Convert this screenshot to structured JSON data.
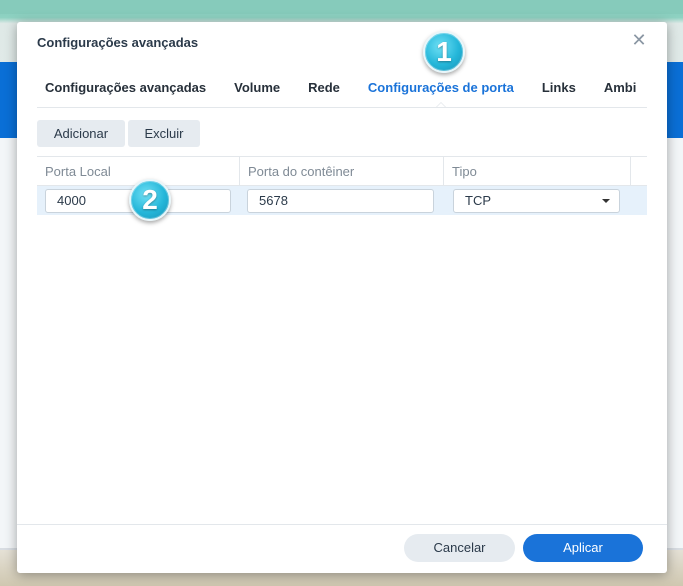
{
  "dialog": {
    "title": "Configurações avançadas",
    "close_icon": "close-icon"
  },
  "tabs": [
    {
      "label": "Configurações avançadas",
      "active": false
    },
    {
      "label": "Volume",
      "active": false
    },
    {
      "label": "Rede",
      "active": false
    },
    {
      "label": "Configurações de porta",
      "active": true
    },
    {
      "label": "Links",
      "active": false
    },
    {
      "label": "Ambi",
      "active": false
    }
  ],
  "toolbar": {
    "add_label": "Adicionar",
    "delete_label": "Excluir"
  },
  "table": {
    "columns": [
      "Porta Local",
      "Porta do contêiner",
      "Tipo"
    ],
    "rows": [
      {
        "local_port": "4000",
        "container_port": "5678",
        "type": "TCP"
      }
    ]
  },
  "footer": {
    "cancel_label": "Cancelar",
    "apply_label": "Aplicar"
  },
  "markers": [
    "1",
    "2"
  ],
  "colors": {
    "accent": "#1a73d9",
    "marker": "#24b6d9"
  }
}
